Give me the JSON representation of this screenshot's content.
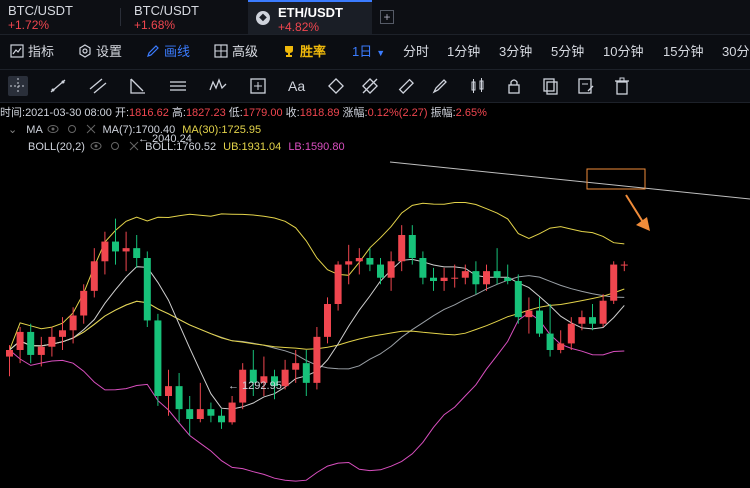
{
  "tabs": [
    {
      "pair": "BTC/USDT",
      "change": "+1.72%"
    },
    {
      "pair": "BTC/USDT",
      "change": "+1.68%"
    },
    {
      "pair": "ETH/USDT",
      "change": "+4.82%",
      "active": true
    }
  ],
  "menu": {
    "indicators": "指标",
    "settings": "设置",
    "draw": "画线",
    "advanced": "高级",
    "winrate": "胜率",
    "interval": "1日",
    "timeshare": "分时",
    "m1": "1分钟",
    "m3": "3分钟",
    "m5": "5分钟",
    "m10": "10分钟",
    "m15": "15分钟",
    "m30": "30分"
  },
  "info": {
    "time_label": "时间:",
    "time": "2021-03-30 08:00",
    "open_label": "开:",
    "open": "1816.62",
    "high_label": "高:",
    "high": "1827.23",
    "low_label": "低:",
    "low": "1779.00",
    "close_label": "收:",
    "close": "1818.89",
    "change_label": "涨幅:",
    "change": "0.12%(2.27)",
    "amp_label": "振幅:",
    "amp": "2.65%"
  },
  "legend": {
    "ma_name": "MA",
    "ma7": "MA(7):1700.40",
    "ma30": "MA(30):1725.95",
    "boll_name": "BOLL(20,2)",
    "boll": "BOLL:1760.52",
    "ub": "UB:1931.04",
    "lb": "LB:1590.80"
  },
  "chart_labels": {
    "high_marker": "2040.24",
    "low_marker": "← 1292.95"
  },
  "colors": {
    "up": "#f0464f",
    "down": "#17c27a",
    "ma7": "#cfcfcf",
    "ma30": "#e3d34a",
    "lb": "#d94fbf",
    "active_tab": "#3b7cff"
  },
  "chart_data": {
    "type": "candlestick",
    "series_note": "ETH/USDT daily",
    "candles": [
      [
        1500,
        1535,
        1440,
        1520
      ],
      [
        1520,
        1590,
        1480,
        1575
      ],
      [
        1575,
        1600,
        1480,
        1505
      ],
      [
        1505,
        1560,
        1470,
        1530
      ],
      [
        1530,
        1590,
        1500,
        1560
      ],
      [
        1560,
        1620,
        1520,
        1580
      ],
      [
        1580,
        1650,
        1540,
        1625
      ],
      [
        1625,
        1720,
        1600,
        1700
      ],
      [
        1700,
        1830,
        1680,
        1790
      ],
      [
        1790,
        1880,
        1750,
        1850
      ],
      [
        1850,
        1920,
        1780,
        1820
      ],
      [
        1820,
        1880,
        1760,
        1830
      ],
      [
        1830,
        1870,
        1770,
        1800
      ],
      [
        1800,
        1820,
        1590,
        1610
      ],
      [
        1610,
        1630,
        1350,
        1380
      ],
      [
        1380,
        1460,
        1320,
        1410
      ],
      [
        1410,
        1450,
        1300,
        1340
      ],
      [
        1340,
        1380,
        1260,
        1310
      ],
      [
        1310,
        1420,
        1300,
        1340
      ],
      [
        1340,
        1360,
        1300,
        1320
      ],
      [
        1320,
        1340,
        1280,
        1300
      ],
      [
        1300,
        1380,
        1292.95,
        1360
      ],
      [
        1360,
        1480,
        1340,
        1460
      ],
      [
        1460,
        1520,
        1380,
        1420
      ],
      [
        1420,
        1500,
        1380,
        1440
      ],
      [
        1440,
        1460,
        1370,
        1410
      ],
      [
        1410,
        1490,
        1400,
        1460
      ],
      [
        1460,
        1520,
        1420,
        1480
      ],
      [
        1480,
        1520,
        1380,
        1420
      ],
      [
        1420,
        1590,
        1400,
        1560
      ],
      [
        1560,
        1680,
        1540,
        1660
      ],
      [
        1660,
        1790,
        1640,
        1780
      ],
      [
        1780,
        1840,
        1720,
        1790
      ],
      [
        1790,
        1830,
        1750,
        1800
      ],
      [
        1800,
        1830,
        1760,
        1780
      ],
      [
        1780,
        1800,
        1720,
        1740
      ],
      [
        1740,
        1820,
        1700,
        1790
      ],
      [
        1790,
        1900,
        1760,
        1870
      ],
      [
        1870,
        1900,
        1780,
        1800
      ],
      [
        1800,
        1820,
        1720,
        1740
      ],
      [
        1740,
        1770,
        1700,
        1730
      ],
      [
        1730,
        1770,
        1700,
        1740
      ],
      [
        1740,
        1780,
        1710,
        1740
      ],
      [
        1740,
        1780,
        1720,
        1760
      ],
      [
        1760,
        1790,
        1690,
        1720
      ],
      [
        1720,
        1780,
        1700,
        1760
      ],
      [
        1760,
        1830,
        1720,
        1740
      ],
      [
        1740,
        1780,
        1720,
        1730
      ],
      [
        1730,
        1750,
        1600,
        1620
      ],
      [
        1620,
        1680,
        1570,
        1640
      ],
      [
        1640,
        1680,
        1560,
        1570
      ],
      [
        1570,
        1660,
        1500,
        1520
      ],
      [
        1520,
        1580,
        1510,
        1540
      ],
      [
        1540,
        1620,
        1520,
        1600
      ],
      [
        1600,
        1640,
        1580,
        1620
      ],
      [
        1620,
        1660,
        1580,
        1600
      ],
      [
        1600,
        1690,
        1590,
        1670
      ],
      [
        1670,
        1790,
        1660,
        1780
      ],
      [
        1780,
        1790,
        1760,
        1780
      ]
    ]
  }
}
